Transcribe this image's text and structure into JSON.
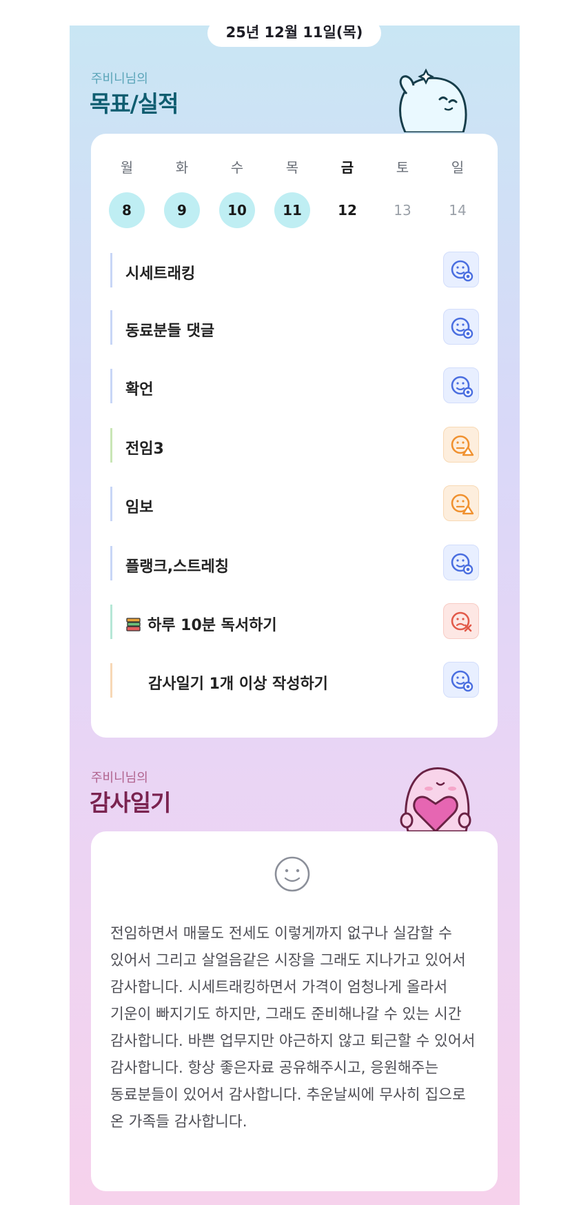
{
  "date_label": "25년 12월 11일(목)",
  "goals_section": {
    "subtitle": "주비니님의",
    "title": "목표/실적"
  },
  "week": {
    "days": [
      {
        "label": "월",
        "num": "8",
        "state": "done"
      },
      {
        "label": "화",
        "num": "9",
        "state": "done"
      },
      {
        "label": "수",
        "num": "10",
        "state": "done"
      },
      {
        "label": "목",
        "num": "11",
        "state": "done"
      },
      {
        "label": "금",
        "num": "12",
        "state": "today"
      },
      {
        "label": "토",
        "num": "13",
        "state": "future"
      },
      {
        "label": "일",
        "num": "14",
        "state": "future"
      }
    ]
  },
  "tasks": [
    {
      "label": "시세트래킹",
      "status": "success",
      "icon": "smile-check-icon"
    },
    {
      "label": "동료분들 댓글",
      "status": "success",
      "icon": "smile-check-icon"
    },
    {
      "label": "확언",
      "status": "success",
      "icon": "smile-check-icon"
    },
    {
      "label": "전임3",
      "status": "partial",
      "icon": "smile-triangle-icon"
    },
    {
      "label": "임보",
      "status": "partial",
      "icon": "smile-triangle-icon"
    },
    {
      "label": "플랭크,스트레칭",
      "status": "success",
      "icon": "smile-check-icon"
    },
    {
      "label": "하루 10분 독서하기",
      "status": "fail",
      "icon": "smile-x-icon",
      "prefix_icon": "books-icon"
    },
    {
      "label": "감사일기 1개 이상 작성하기",
      "status": "success",
      "icon": "smile-check-icon"
    }
  ],
  "diary_section": {
    "subtitle": "주비니님의",
    "title": "감사일기",
    "text": "전임하면서 매물도 전세도 이렇게까지 없구나 실감할 수 있어서 그리고 살얼음같은 시장을 그래도 지나가고 있어서 감사합니다. 시세트래킹하면서 가격이 엄청나게 올라서 기운이 빠지기도 하지만, 그래도 준비해나갈 수 있는 시간 감사합니다. 바쁜 업무지만 야근하지 않고 퇴근할 수 있어서 감사합니다. 항상 좋은자료 공유해주시고, 응원해주는 동료분들이 있어서 감사합니다. 추운날씨에 무사히 집으로 온 가족들 감사합니다."
  },
  "colors": {
    "accent_teal": "#0f5d70",
    "accent_plum": "#7a2350",
    "done_day": "#bfeef3",
    "success": "#4a6ee0",
    "partial": "#f0912f",
    "fail": "#e25a4a"
  }
}
